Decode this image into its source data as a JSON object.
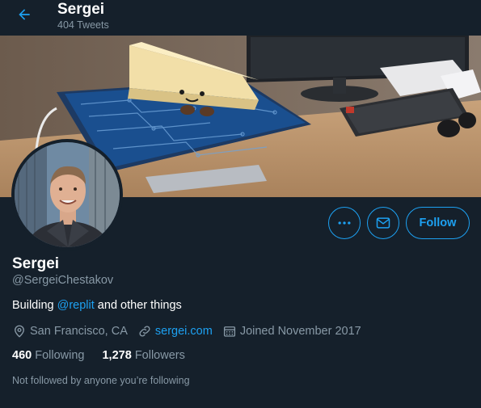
{
  "header": {
    "back_icon": "arrow-left-icon",
    "name": "Sergei",
    "tweet_count": "404 Tweets"
  },
  "banner": {
    "description_icon": "desk-photo"
  },
  "avatar": {
    "icon": "profile-photo"
  },
  "actions": {
    "more_icon": "more-horizontal-icon",
    "message_icon": "envelope-icon",
    "follow_label": "Follow"
  },
  "profile": {
    "name": "Sergei",
    "handle": "@SergeiChestakov",
    "bio_prefix": "Building ",
    "bio_mention": "@replit",
    "bio_suffix": " and other things",
    "location": "San Francisco, CA",
    "website": "sergei.com",
    "joined": "Joined November 2017",
    "following_count": "460",
    "following_label": "Following",
    "followers_count": "1,278",
    "followers_label": "Followers",
    "follow_note": "Not followed by anyone you’re following"
  },
  "colors": {
    "background": "#15202b",
    "accent": "#1da1f2",
    "secondary_text": "#8899a6"
  }
}
